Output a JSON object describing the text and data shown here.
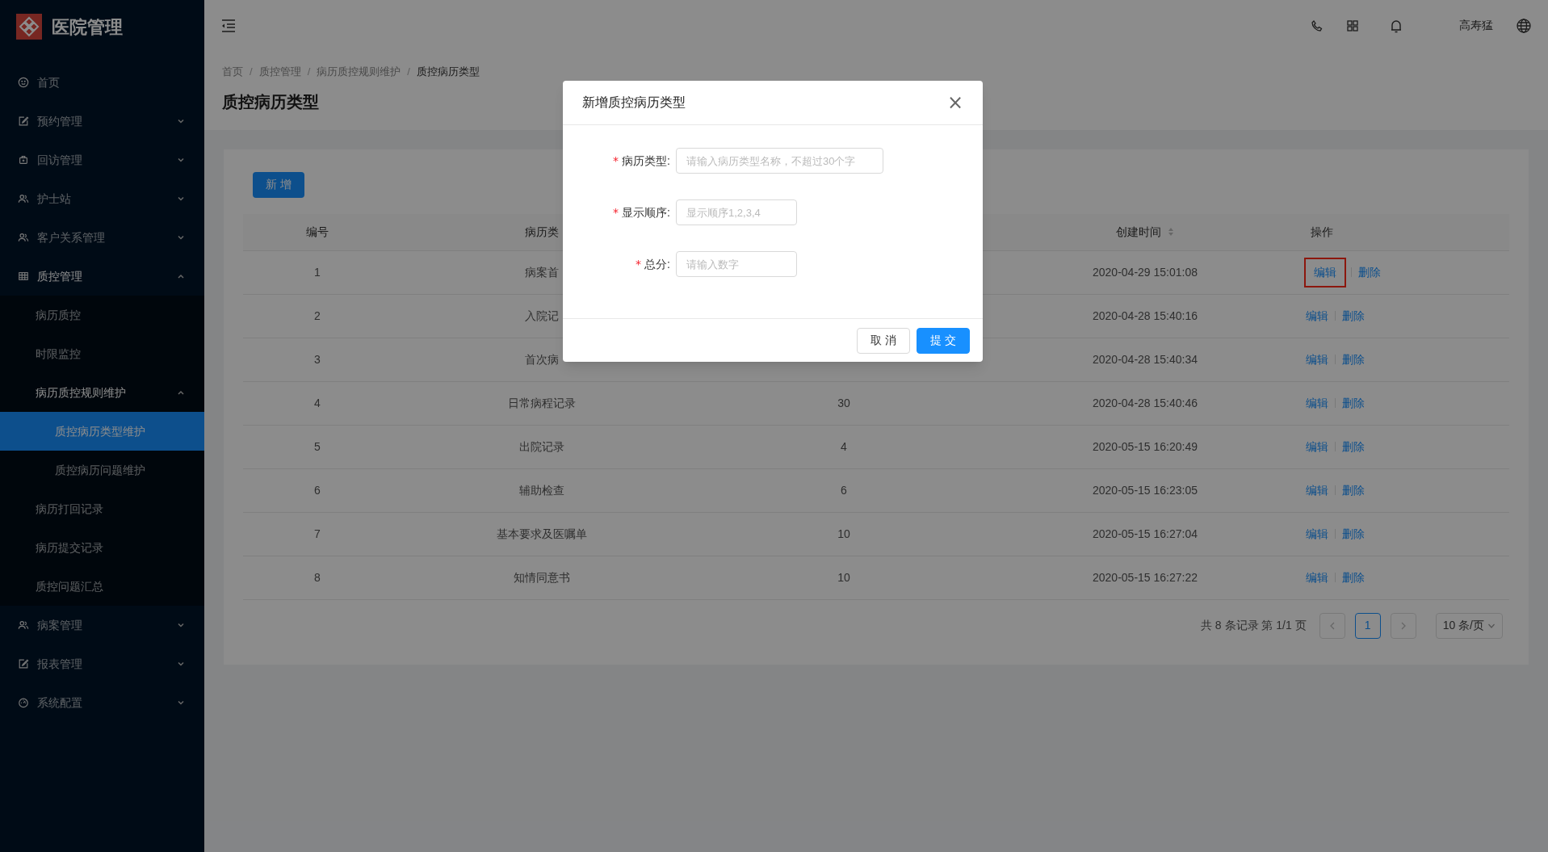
{
  "app": {
    "title": "医院管理"
  },
  "sidebar": {
    "items": [
      {
        "label": "首页",
        "expanded": false,
        "has_children": false
      },
      {
        "label": "预约管理",
        "expanded": false,
        "has_children": true
      },
      {
        "label": "回访管理",
        "expanded": false,
        "has_children": true
      },
      {
        "label": "护士站",
        "expanded": false,
        "has_children": true
      },
      {
        "label": "客户关系管理",
        "expanded": false,
        "has_children": true
      },
      {
        "label": "质控管理",
        "expanded": true,
        "has_children": true,
        "children": [
          {
            "label": "病历质控",
            "selected": false
          },
          {
            "label": "时限监控",
            "selected": false
          },
          {
            "label": "病历质控规则维护",
            "expanded": true,
            "children": [
              {
                "label": "质控病历类型维护",
                "selected": true
              },
              {
                "label": "质控病历问题维护",
                "selected": false
              }
            ]
          },
          {
            "label": "病历打回记录",
            "selected": false
          },
          {
            "label": "病历提交记录",
            "selected": false
          },
          {
            "label": "质控问题汇总",
            "selected": false
          }
        ]
      },
      {
        "label": "病案管理",
        "expanded": false,
        "has_children": true
      },
      {
        "label": "报表管理",
        "expanded": false,
        "has_children": true
      },
      {
        "label": "系统配置",
        "expanded": false,
        "has_children": true
      }
    ]
  },
  "header": {
    "user": "高寿猛"
  },
  "breadcrumb": [
    {
      "label": "首页"
    },
    {
      "separator": "/",
      "label": "质控管理"
    },
    {
      "separator": "/",
      "label": "病历质控规则维护"
    },
    {
      "separator": "/",
      "label": "质控病历类型"
    }
  ],
  "page_title": "质控病历类型",
  "add_button": "新 增",
  "table": {
    "columns": [
      "编号",
      "病历类",
      "",
      "创建时间",
      "操作"
    ],
    "rows": [
      {
        "cells": [
          "1",
          "病案首",
          "",
          "2020-04-29 15:01:08"
        ],
        "actions": [
          "编辑",
          "删除"
        ],
        "highlighted": true
      },
      {
        "cells": [
          "2",
          "入院记",
          "",
          "2020-04-28 15:40:16"
        ],
        "actions": [
          "编辑",
          "删除"
        ],
        "highlighted": false
      },
      {
        "cells": [
          "3",
          "首次病",
          "",
          "2020-04-28 15:40:34"
        ],
        "actions": [
          "编辑",
          "删除"
        ],
        "highlighted": false
      },
      {
        "cells": [
          "4",
          "日常病程记录",
          "30",
          "2020-04-28 15:40:46"
        ],
        "actions": [
          "编辑",
          "删除"
        ],
        "highlighted": false
      },
      {
        "cells": [
          "5",
          "出院记录",
          "4",
          "2020-05-15 16:20:49"
        ],
        "actions": [
          "编辑",
          "删除"
        ],
        "highlighted": false
      },
      {
        "cells": [
          "6",
          "辅助检查",
          "6",
          "2020-05-15 16:23:05"
        ],
        "actions": [
          "编辑",
          "删除"
        ],
        "highlighted": false
      },
      {
        "cells": [
          "7",
          "基本要求及医嘱单",
          "10",
          "2020-05-15 16:27:04"
        ],
        "actions": [
          "编辑",
          "删除"
        ],
        "highlighted": false
      },
      {
        "cells": [
          "8",
          "知情同意书",
          "10",
          "2020-05-15 16:27:22"
        ],
        "actions": [
          "编辑",
          "删除"
        ],
        "highlighted": false
      }
    ]
  },
  "pagination": {
    "summary": "共 8 条记录 第 1/1 页",
    "pages": [
      {
        "label": "1",
        "selected": true
      }
    ],
    "page_size": "10 条/页"
  },
  "dialog": {
    "title": "新增质控病历类型",
    "close": "×",
    "fields": [
      {
        "label": "病历类型:",
        "required_mark": "*",
        "placeholder": "请输入病历类型名称，不超过30个字",
        "wide": true
      },
      {
        "label": "显示顺序:",
        "required_mark": "*",
        "placeholder": "显示顺序1,2,3,4",
        "wide": false
      },
      {
        "label": "总分:",
        "required_mark": "*",
        "placeholder": "请输入数字",
        "wide": false
      }
    ],
    "buttons": [
      {
        "label": "取 消",
        "kind": "default"
      },
      {
        "label": "提 交",
        "kind": "primary"
      }
    ]
  }
}
